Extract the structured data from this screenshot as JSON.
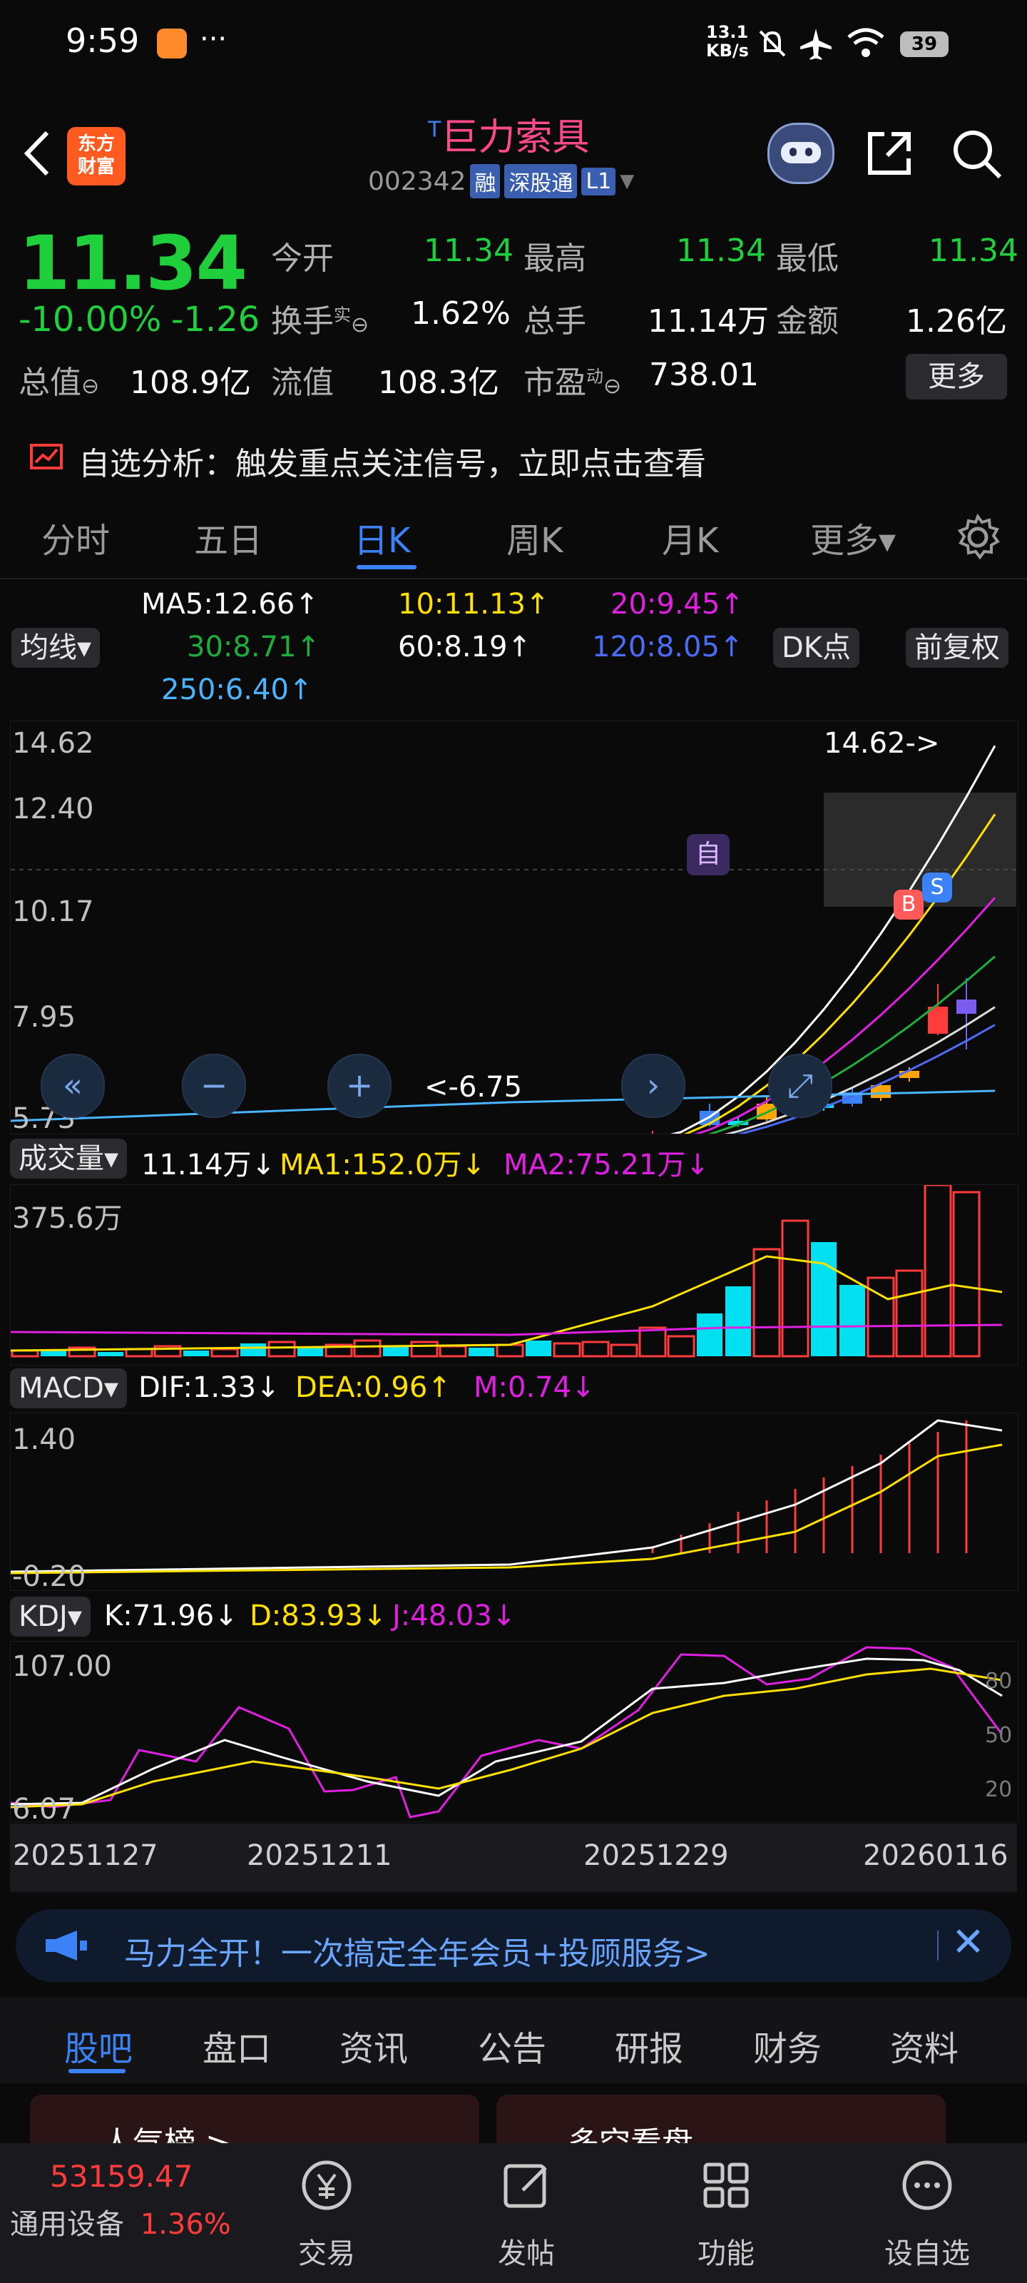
{
  "status": {
    "time": "9:59",
    "dots": "···",
    "net_speed": "13.1\nKB/s",
    "net_speed_line1": "13.1",
    "net_speed_line2": "KB/s",
    "battery": "39"
  },
  "header": {
    "logo_line1": "东方",
    "logo_line2": "财富",
    "title_prefix": "T",
    "title": "巨力索具",
    "code": "002342",
    "tag_rong": "融",
    "tag_sgt": "深股通",
    "tag_l1": "L1"
  },
  "quote": {
    "price": "11.34",
    "change_pct": "-10.00%",
    "change": "-1.26",
    "fields": {
      "open_label": "今开",
      "open": "11.34",
      "high_label": "最高",
      "high": "11.34",
      "low_label": "最低",
      "low": "11.34",
      "turnover_label": "换手",
      "turnover_sup": "实",
      "turnover": "1.62%",
      "volume_label": "总手",
      "volume": "11.14万",
      "amount_label": "金额",
      "amount": "1.26亿",
      "mktcap_label": "总值",
      "mktcap": "108.9亿",
      "float_label": "流值",
      "float": "108.3亿",
      "pe_label": "市盈",
      "pe_sup": "动",
      "pe": "738.01",
      "more": "更多"
    }
  },
  "banner": {
    "text": "自选分析：触发重点关注信号，立即点击查看"
  },
  "tabs": [
    "分时",
    "五日",
    "日K",
    "周K",
    "月K",
    "更多▾"
  ],
  "active_tab": "日K",
  "ma": {
    "selector": "均线▾",
    "dk_button": "DK点",
    "adj_button": "前复权",
    "ma5": "MA5:12.66↑",
    "ma10": "10:11.13↑",
    "ma20": "20:9.45↑",
    "ma30": "30:8.71↑",
    "ma60": "60:8.19↑",
    "ma120": "120:8.05↑",
    "ma250": "250:6.40↑",
    "colors": {
      "ma5": "#ffffff",
      "ma10": "#ffe000",
      "ma20": "#e020e0",
      "ma30": "#1fae3c",
      "ma60": "#ffffff",
      "ma120": "#4a6cf7",
      "ma250": "#4ab4ff"
    }
  },
  "kchart": {
    "y_ticks": [
      "14.62",
      "12.40",
      "10.17",
      "7.95",
      "5.73"
    ],
    "high_label": "14.62->",
    "low_label": "<-6.75",
    "marker_zi": "自",
    "marker_b": "B",
    "marker_s": "S"
  },
  "volume": {
    "selector": "成交量▾",
    "current": "11.14万↓",
    "ma1": "MA1:152.0万↓",
    "ma2": "MA2:75.21万↓",
    "y_top": "375.6万"
  },
  "macd": {
    "selector": "MACD▾",
    "dif": "DIF:1.33↓",
    "dea": "DEA:0.96↑",
    "m": "M:0.74↓",
    "y_top": "1.40",
    "y_bottom": "-0.20"
  },
  "kdj": {
    "selector": "KDJ▾",
    "k": "K:71.96↓",
    "d": "D:83.93↓",
    "j": "J:48.03↓",
    "y_top": "107.00",
    "y_bottom": "6.07",
    "right_80": "80",
    "right_50": "50",
    "right_20": "20"
  },
  "x_dates": [
    "20251127",
    "20251211",
    "20251229",
    "20260116"
  ],
  "promo": {
    "text": "马力全开！一次搞定全年会员+投顾服务>"
  },
  "bottom_tabs": [
    "股吧",
    "盘口",
    "资讯",
    "公告",
    "研报",
    "财务",
    "资料"
  ],
  "bottom_active": "股吧",
  "peek_cards": {
    "left": "人气榜 >",
    "right": "多空看盘"
  },
  "index": {
    "value": "53159.47",
    "name": "通用设备",
    "pct": "1.36%"
  },
  "nav": [
    "交易",
    "发帖",
    "功能",
    "设自选"
  ],
  "colors": {
    "up": "#ff3b3b",
    "down": "#1fcf3c",
    "accent": "#3b82f6"
  }
}
